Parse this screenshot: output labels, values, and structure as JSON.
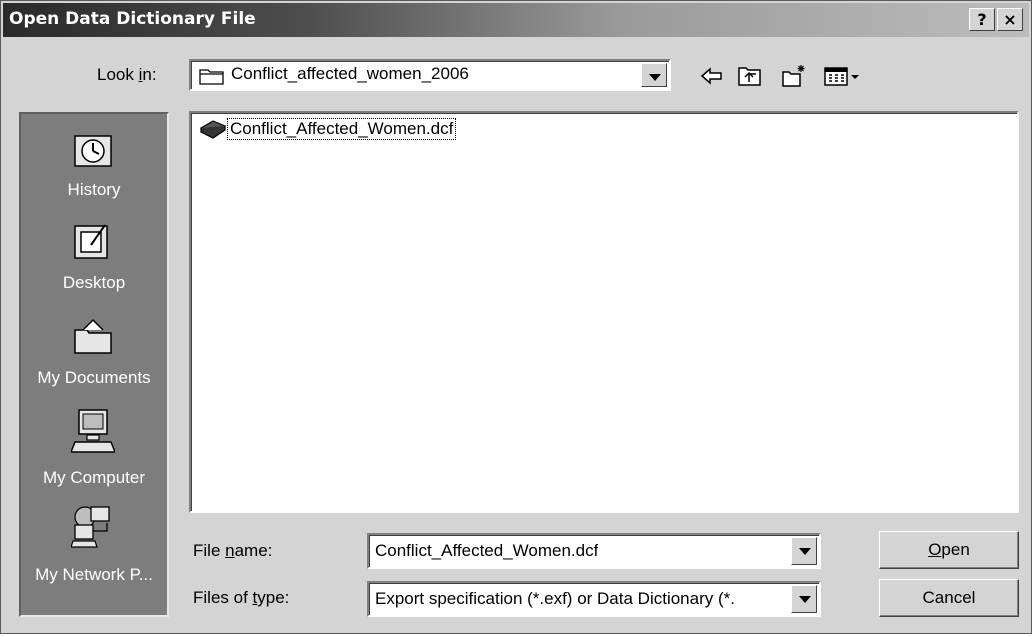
{
  "dialog": {
    "title": "Open Data Dictionary File",
    "help_label": "?",
    "close_label": "×"
  },
  "look_in": {
    "label_pre": "Look ",
    "label_u": "i",
    "label_post": "n:",
    "value": "Conflict_affected_women_2006"
  },
  "toolbar": {
    "icons": [
      "back-arrow-icon",
      "up-one-level-icon",
      "new-folder-icon",
      "view-menu-icon"
    ]
  },
  "places": [
    {
      "label": "History",
      "icon": "history-icon"
    },
    {
      "label": "Desktop",
      "icon": "desktop-icon"
    },
    {
      "label": "My Documents",
      "icon": "my-documents-icon"
    },
    {
      "label": "My Computer",
      "icon": "my-computer-icon"
    },
    {
      "label": "My Network P...",
      "icon": "my-network-places-icon"
    }
  ],
  "file_list": {
    "items": [
      {
        "name": "Conflict_Affected_Women.dcf",
        "icon": "dictionary-file-icon"
      }
    ]
  },
  "file_name": {
    "label_pre": "File ",
    "label_u": "n",
    "label_post": "ame:",
    "value": "Conflict_Affected_Women.dcf"
  },
  "file_type": {
    "label_pre": "Files of ",
    "label_u": "t",
    "label_post": "ype:",
    "value": "Export specification (*.exf) or Data Dictionary (*."
  },
  "buttons": {
    "open_u": "O",
    "open_rest": "pen",
    "cancel": "Cancel"
  }
}
